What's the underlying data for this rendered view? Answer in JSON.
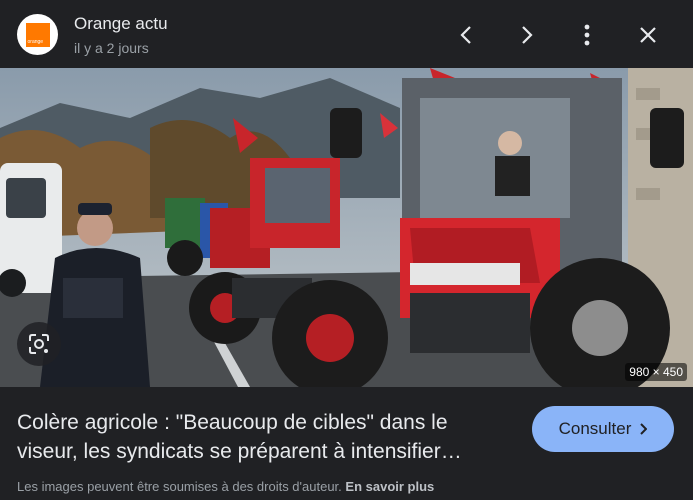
{
  "header": {
    "source_name": "Orange actu",
    "time": "il y a 2 jours",
    "logo_text": "orange"
  },
  "image": {
    "dimensions": "980 × 450"
  },
  "article": {
    "title": "Colère agricole : \"Beaucoup de cibles\" dans le viseur, les syndicats se préparent à intensifier…"
  },
  "actions": {
    "consult_label": "Consulter"
  },
  "footer": {
    "notice": "Les images peuvent être soumises à des droits d'auteur.",
    "more_label": "En savoir plus"
  },
  "colors": {
    "background": "#202124",
    "accent": "#8ab4f8",
    "brand": "#ff7900"
  },
  "icons": [
    "chevron-left-icon",
    "chevron-right-icon",
    "more-vert-icon",
    "close-icon",
    "lens-icon",
    "chevron-right-small-icon"
  ]
}
